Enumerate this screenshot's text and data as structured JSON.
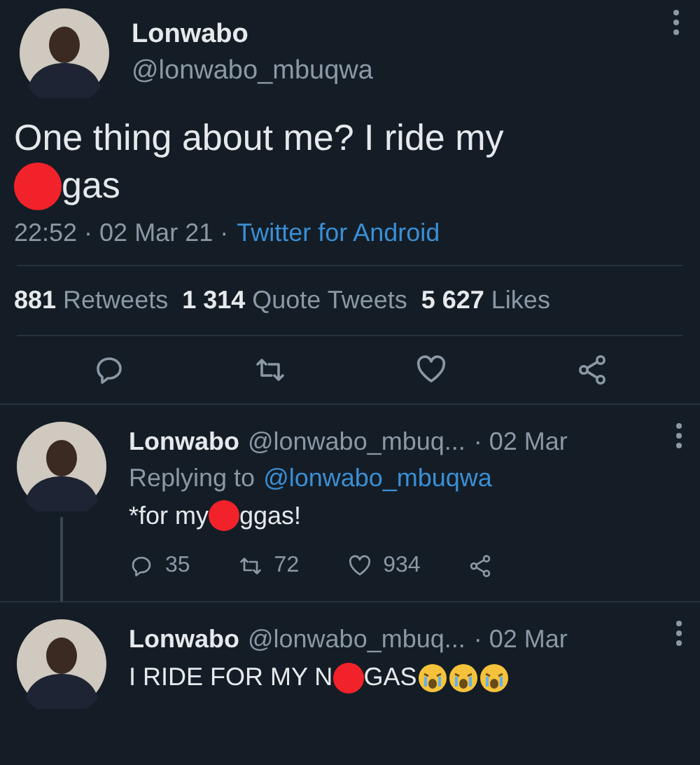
{
  "tweet": {
    "name": "Lonwabo",
    "handle": "@lonwabo_mbuqwa",
    "lines": [
      [
        {
          "kind": "text",
          "text": "One thing about me? I ride my"
        }
      ],
      [
        {
          "kind": "censor"
        },
        {
          "kind": "text",
          "text": "gas"
        }
      ]
    ],
    "meta": "22:52 · 02 Mar 21 ·",
    "source": "Twitter for Android",
    "stats": [
      {
        "count": "881",
        "label": "Retweets"
      },
      {
        "count": "1 314",
        "label": "Quote Tweets"
      },
      {
        "count": "5 627",
        "label": "Likes"
      }
    ]
  },
  "replies": [
    {
      "name": "Lonwabo",
      "handle": "@lonwabo_mbuq...",
      "date": "· 02 Mar",
      "replying_prefix": "Replying to",
      "replying_handle": "@lonwabo_mbuqwa",
      "lines": [
        [
          {
            "kind": "text",
            "text": "*for my"
          },
          {
            "kind": "censor"
          },
          {
            "kind": "text",
            "text": "ggas!"
          }
        ]
      ],
      "counts": [
        "35",
        "72",
        "934"
      ],
      "thread_below": true
    },
    {
      "name": "Lonwabo",
      "handle": "@lonwabo_mbuq...",
      "date": "· 02 Mar",
      "lines": [
        [
          {
            "kind": "text",
            "text": "I RIDE FOR MY N"
          },
          {
            "kind": "censor"
          },
          {
            "kind": "text",
            "text": "GAS"
          },
          {
            "kind": "emoji"
          },
          {
            "kind": "emoji"
          },
          {
            "kind": "emoji"
          }
        ]
      ],
      "thread_below": false
    }
  ]
}
